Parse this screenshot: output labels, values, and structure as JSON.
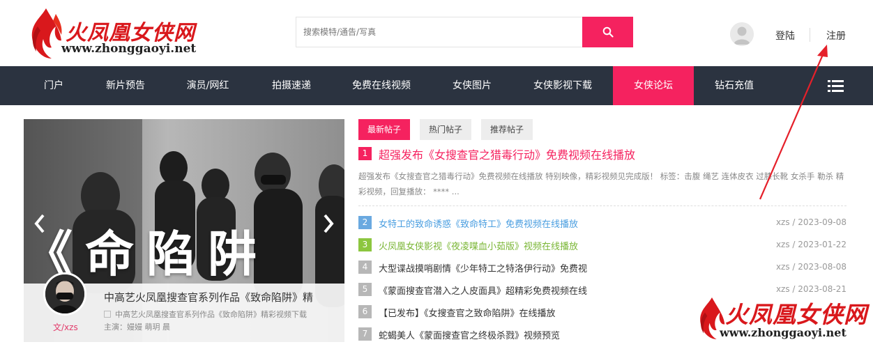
{
  "header": {
    "logo_text": "火凤凰女侠网",
    "logo_url": "www.zhonggaoyi.net",
    "search_placeholder": "搜索模特/通告/写真",
    "login_label": "登陆",
    "register_label": "注册"
  },
  "nav": {
    "items": [
      {
        "label": "门户"
      },
      {
        "label": "新片预告"
      },
      {
        "label": "演员/网红"
      },
      {
        "label": "拍摄速递"
      },
      {
        "label": "免费在线视频"
      },
      {
        "label": "女侠图片"
      },
      {
        "label": "女侠影视下载"
      },
      {
        "label": "女侠论坛"
      },
      {
        "label": "钻石充值"
      }
    ],
    "active_label": "女侠论坛"
  },
  "slider": {
    "big_text": "《命陷阱",
    "caption_title": "中高艺火凤凰搜查官系列作品《致命陷阱》精",
    "caption_desc": "中高艺火凤凰搜查官系列作品《致命陷阱》精彩视频下载",
    "caption_cast": "主演：嫚嫚 萌玥 晨",
    "author": "文/xzs"
  },
  "tabs": {
    "items": [
      {
        "label": "最新帖子"
      },
      {
        "label": "热门帖子"
      },
      {
        "label": "推荐帖子"
      }
    ]
  },
  "featured": {
    "num": "1",
    "title": "超强发布《女搜查官之猎毒行动》免费视频在线播放",
    "desc": "超强发布《女搜查官之猎毒行动》免费视频在线播放 特别映像，精彩视频见完成版！ 标签：击腹 绳艺 连体皮衣 过膝长靴 女杀手 勒杀 精彩视频，回复播放：  **** ..."
  },
  "posts": [
    {
      "num": "2",
      "title": "女特工的致命诱惑《致命特工》免费视频在线播放",
      "meta": "xzs / 2023-09-08"
    },
    {
      "num": "3",
      "title": "火凤凰女侠影视《夜凌喋血小茹版》视频在线播放",
      "meta": "xzs / 2023-01-22"
    },
    {
      "num": "4",
      "title": "大型谍战摸哨剧情《少年特工之特洛伊行动》免费视",
      "meta": "xzs / 2023-08-08"
    },
    {
      "num": "5",
      "title": "《蒙面搜查官潜入之人皮面具》超精彩免费视频在线",
      "meta": "xzs / 2023-08-21"
    },
    {
      "num": "6",
      "title": "【已发布】《女搜查官之致命陷阱》在线播放",
      "meta": ""
    },
    {
      "num": "7",
      "title": "蛇蝎美人《蒙面搜查官之终极杀戮》视频预览",
      "meta": ""
    }
  ],
  "watermark": {
    "text": "火凤凰女侠网",
    "url": "www.zhonggaoyi.net"
  },
  "colors": {
    "accent": "#f5225f",
    "nav_bg": "#2b3340",
    "num2": "#6aa9e0",
    "num3": "#8cc63f",
    "num_rest": "#b7b7b7",
    "title2": "#4a9ee0",
    "title3": "#7ab635"
  },
  "icons": {
    "search": "search-icon",
    "user": "user-avatar-icon",
    "menu": "list-menu-icon",
    "prev": "chevron-left-icon",
    "next": "chevron-right-icon"
  }
}
